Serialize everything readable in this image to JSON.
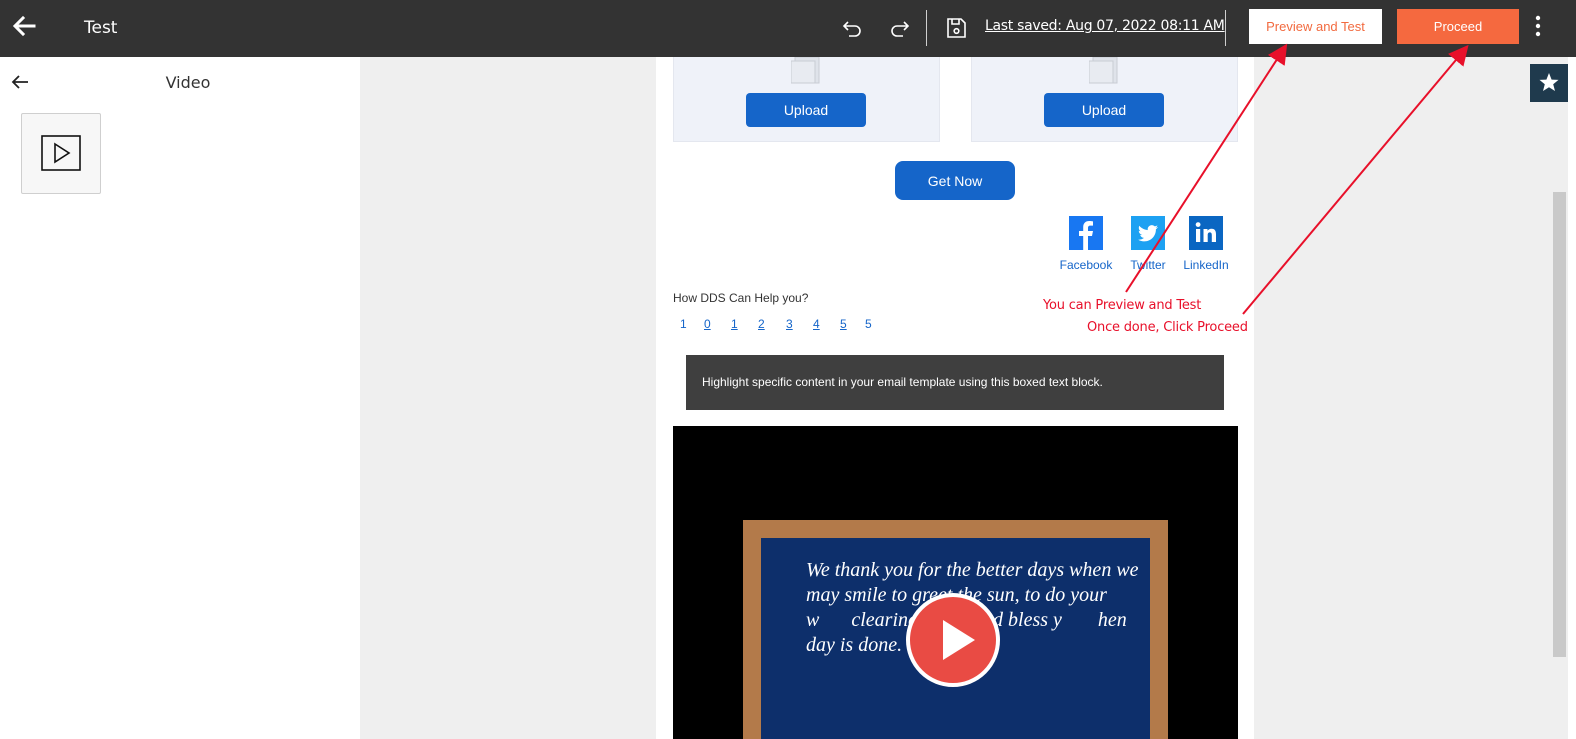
{
  "topbar": {
    "title": "Test",
    "last_saved": "Last saved: Aug 07, 2022 08:11 AM",
    "preview_label": "Preview and Test",
    "proceed_label": "Proceed"
  },
  "left_panel": {
    "title": "Video"
  },
  "email": {
    "upload_label_1": "Upload",
    "upload_label_2": "Upload",
    "cta_label": "Get Now",
    "social": [
      {
        "label": "Facebook",
        "color": "#1877f2"
      },
      {
        "label": "Twitter",
        "color": "#1da1f2"
      },
      {
        "label": "LinkedIn",
        "color": "#0a66c2"
      }
    ],
    "help_question": "How DDS Can Help you?",
    "nps_scale": [
      "1",
      "0",
      "1",
      "2",
      "3",
      "4",
      "5",
      "5"
    ],
    "boxed_text": "Highlight specific content in your email template using this boxed text block.",
    "video_poem": "We thank you for the better days when we may smile to greet the sun, to do your w        clearing mind, and bless y         hen day is done."
  },
  "annotations": {
    "line1": "You can Preview and Test",
    "line2": "Once done, Click Proceed"
  },
  "colors": {
    "topbar_bg": "#333333",
    "accent_orange": "#f5693f",
    "primary_blue": "#1565c9",
    "annotation_red": "#e8102a"
  }
}
